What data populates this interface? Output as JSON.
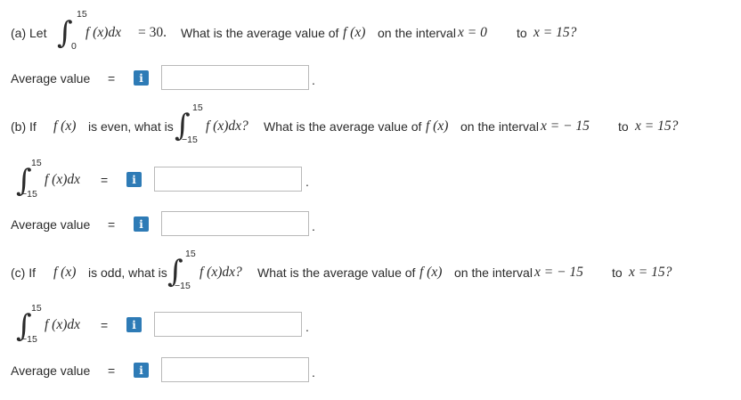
{
  "part_a": {
    "label": "(a) Let",
    "upper": "15",
    "lower": "0",
    "integrand": "f (x)dx",
    "eq": "= 30.",
    "question": "What is the average value of",
    "fx": "f (x)",
    "interval_text": "on the interval",
    "from": "x = 0",
    "to_word": "to",
    "to": "x = 15?",
    "answer_label": "Average value",
    "eq_sign": "="
  },
  "part_b": {
    "label": "(b) If",
    "fx": "f (x)",
    "condition": "is even, what is",
    "upper": "15",
    "lower": "−15",
    "integrand_q": "f (x)dx?",
    "question": "What is the average value of",
    "fx2": "f (x)",
    "interval_text": "on the interval",
    "from": "x = − 15",
    "to_word": "to",
    "to": "x = 15?",
    "integral_row": {
      "upper": "15",
      "lower": "−15",
      "integrand": "f (x)dx",
      "eq_sign": "="
    },
    "answer_label": "Average value",
    "eq_sign": "="
  },
  "part_c": {
    "label": "(c) If",
    "fx": "f (x)",
    "condition": "is odd, what is",
    "upper": "15",
    "lower": "−15",
    "integrand_q": "f (x)dx?",
    "question": "What is the average value of",
    "fx2": "f (x)",
    "interval_text": "on the interval",
    "from": "x = − 15",
    "to_word": "to",
    "to": "x = 15?",
    "integral_row": {
      "upper": "15",
      "lower": "−15",
      "integrand": "f (x)dx",
      "eq_sign": "="
    },
    "answer_label": "Average value",
    "eq_sign": "="
  },
  "info_icon_glyph": "i",
  "period": ".",
  "colors": {
    "info_icon": "#2e7bb6",
    "field_border": "#b9b9b9",
    "text": "#2b2b2b"
  }
}
